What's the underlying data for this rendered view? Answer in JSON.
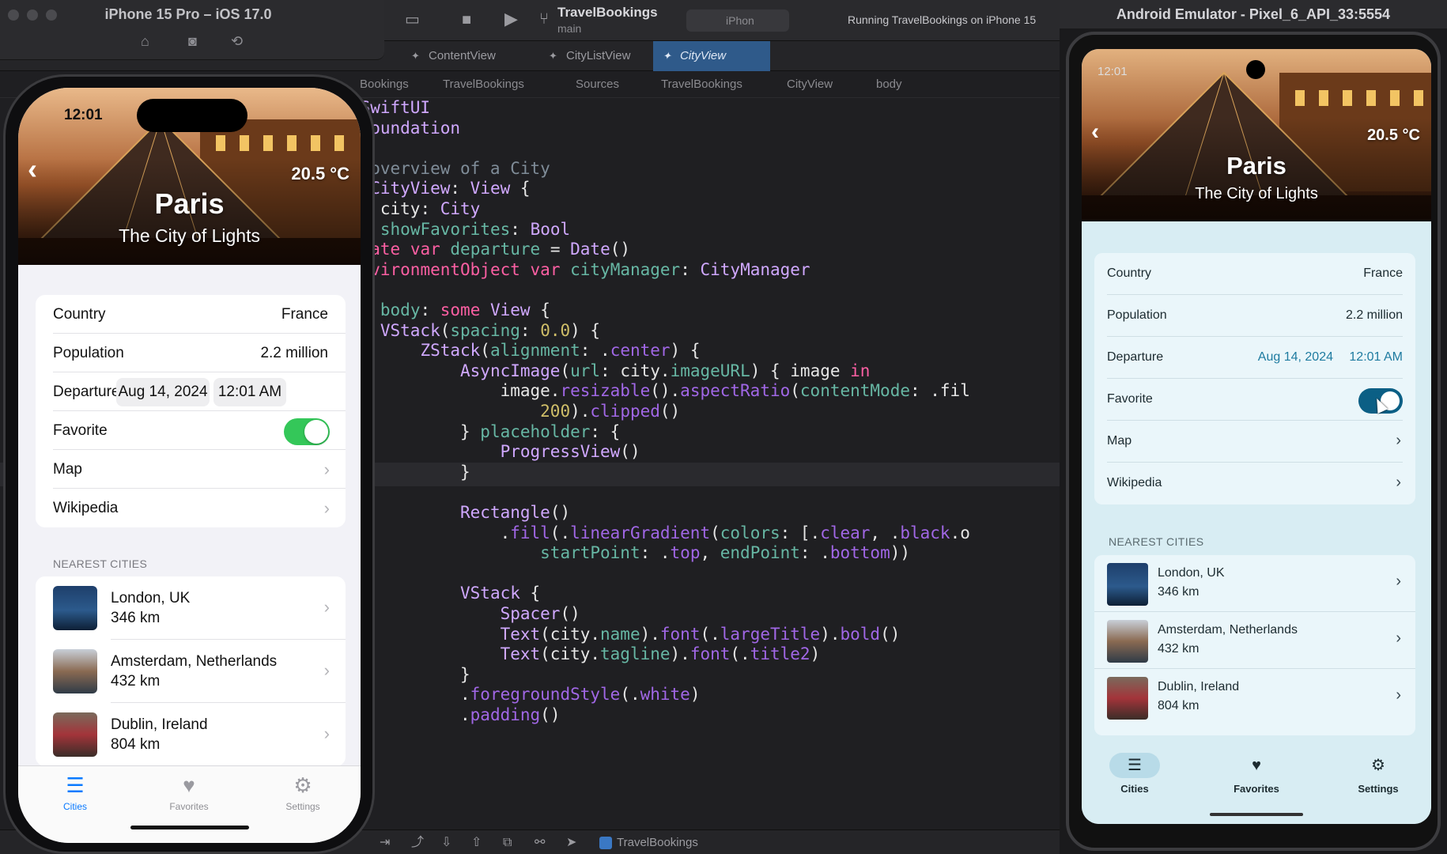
{
  "xcode": {
    "scheme": "TravelBookings",
    "branch": "main",
    "destination": "iPhon",
    "status": "Running TravelBookings on iPhone 15",
    "tabs": [
      {
        "label": "ContentView"
      },
      {
        "label": "CityListView"
      },
      {
        "label": "CityView"
      }
    ],
    "breadcrumb": [
      "Bookings",
      "TravelBookings",
      "Sources",
      "TravelBookings",
      "CityView",
      "body"
    ],
    "debug_target": "TravelBookings"
  },
  "ios": {
    "window_title": "iPhone 15 Pro – iOS 17.0",
    "status_time": "12:01",
    "temperature": "20.5 °C",
    "city_name": "Paris",
    "tagline": "The City of Lights",
    "details": {
      "country_label": "Country",
      "country_value": "France",
      "population_label": "Population",
      "population_value": "2.2 million",
      "departure_label": "Departure",
      "departure_date": "Aug 14, 2024",
      "departure_time": "12:01 AM",
      "favorite_label": "Favorite",
      "favorite_on": true,
      "map_label": "Map",
      "wikipedia_label": "Wikipedia"
    },
    "nearest_header": "NEAREST CITIES",
    "nearest": [
      {
        "name": "London, UK",
        "distance": "346 km"
      },
      {
        "name": "Amsterdam, Netherlands",
        "distance": "432 km"
      },
      {
        "name": "Dublin, Ireland",
        "distance": "804 km"
      }
    ],
    "tabs": [
      {
        "label": "Cities",
        "icon": "list-icon"
      },
      {
        "label": "Favorites",
        "icon": "heart-icon"
      },
      {
        "label": "Settings",
        "icon": "gear-icon"
      }
    ],
    "accent": "#0a7aff",
    "toggle_color": "#34c759"
  },
  "android": {
    "window_title": "Android Emulator - Pixel_6_API_33:5554",
    "status_time": "12:01",
    "temperature": "20.5 °C",
    "city_name": "Paris",
    "tagline": "The City of Lights",
    "details": {
      "country_label": "Country",
      "country_value": "France",
      "population_label": "Population",
      "population_value": "2.2 million",
      "departure_label": "Departure",
      "departure_date": "Aug 14, 2024",
      "departure_time": "12:01 AM",
      "favorite_label": "Favorite",
      "favorite_on": true,
      "map_label": "Map",
      "wikipedia_label": "Wikipedia"
    },
    "nearest_header": "NEAREST CITIES",
    "nearest": [
      {
        "name": "London, UK",
        "distance": "346 km"
      },
      {
        "name": "Amsterdam, Netherlands",
        "distance": "432 km"
      },
      {
        "name": "Dublin, Ireland",
        "distance": "804 km"
      }
    ],
    "nav": [
      {
        "label": "Cities",
        "icon": "list-icon"
      },
      {
        "label": "Favorites",
        "icon": "heart-icon"
      },
      {
        "label": "Settings",
        "icon": "gear-icon"
      }
    ],
    "accent": "#0b5f85"
  },
  "code_lines": [
    "ort SwiftUI",
    "ort Foundation",
    "",
    "/ An overview of a City",
    "ruct CityView: View {",
    "  let city: City",
    "  let showFavorites: Bool",
    "  @State var departure = Date()",
    "  @EnvironmentObject var cityManager: CityManager",
    "",
    "  var body: some View {",
    "      VStack(spacing: 0.0) {",
    "          ZStack(alignment: .center) {",
    "              AsyncImage(url: city.imageURL) { image in",
    "                  image.resizable().aspectRatio(contentMode: .fil",
    "                      200).clipped()",
    "              } placeholder: {",
    "                  ProgressView()",
    "              }",
    "",
    "              Rectangle()",
    "                  .fill(.linearGradient(colors: [.clear, .black.o",
    "                      startPoint: .top, endPoint: .bottom))",
    "",
    "              VStack {",
    "                  Spacer()",
    "                  Text(city.name).font(.largeTitle).bold()",
    "                  Text(city.tagline).font(.title2)",
    "              }",
    "              .foregroundStyle(.white)",
    "              .padding()"
  ]
}
